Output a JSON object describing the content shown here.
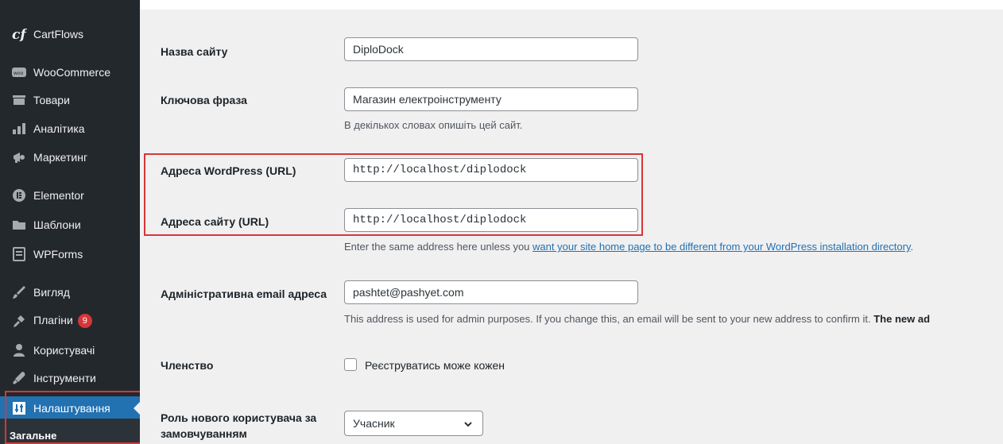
{
  "sidebar": {
    "items": [
      {
        "label": "CartFlows",
        "icon": "cartflows-icon"
      },
      {
        "label": "WooCommerce",
        "icon": "woocommerce-icon"
      },
      {
        "label": "Товари",
        "icon": "products-icon"
      },
      {
        "label": "Аналітика",
        "icon": "analytics-icon"
      },
      {
        "label": "Маркетинг",
        "icon": "marketing-icon"
      },
      {
        "label": "Elementor",
        "icon": "elementor-icon"
      },
      {
        "label": "Шаблони",
        "icon": "folder-icon"
      },
      {
        "label": "WPForms",
        "icon": "wpforms-icon"
      },
      {
        "label": "Вигляд",
        "icon": "appearance-icon"
      },
      {
        "label": "Плагіни",
        "icon": "plugins-icon",
        "badge": "9"
      },
      {
        "label": "Користувачі",
        "icon": "users-icon"
      },
      {
        "label": "Інструменти",
        "icon": "tools-icon"
      },
      {
        "label": "Налаштування",
        "icon": "settings-icon"
      }
    ],
    "submenu": {
      "label": "Загальне"
    }
  },
  "form": {
    "site_title": {
      "label": "Назва сайту",
      "value": "DiploDock"
    },
    "tagline": {
      "label": "Ключова фраза",
      "value": "Магазин електроінструменту",
      "description": "В декількох словах опишіть цей сайт."
    },
    "wp_address": {
      "label": "Адреса WordPress (URL)",
      "value": "http://localhost/diplodock"
    },
    "site_address": {
      "label": "Адреса сайту (URL)",
      "value": "http://localhost/diplodock",
      "description_prefix": "Enter the same address here unless you ",
      "description_link": "want your site home page to be different from your WordPress installation directory",
      "description_suffix": "."
    },
    "admin_email": {
      "label": "Адміністративна email адреса",
      "value": "pashtet@pashyet.com",
      "description": "This address is used for admin purposes. If you change this, an email will be sent to your new address to confirm it. ",
      "description_bold": "The new ad"
    },
    "membership": {
      "label": "Членство",
      "checkbox_label": "Реєструватись може кожен"
    },
    "default_role": {
      "label_line1": "Роль нового користувача за",
      "label_line2": "замовчуванням",
      "value": "Учасник"
    }
  },
  "colors": {
    "sidebar_bg": "#23282d",
    "active": "#2271b1",
    "highlight": "#d63638"
  }
}
